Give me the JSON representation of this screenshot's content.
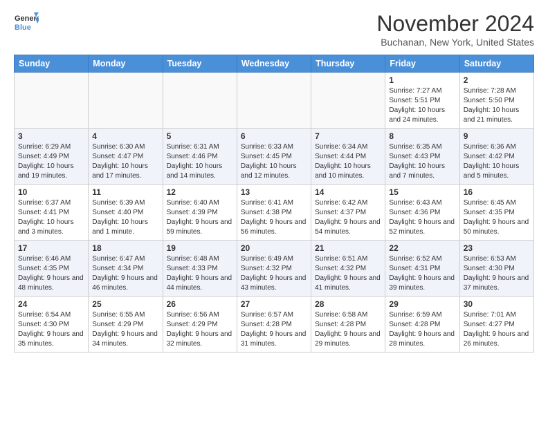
{
  "header": {
    "logo_line1": "General",
    "logo_line2": "Blue",
    "month_title": "November 2024",
    "location": "Buchanan, New York, United States"
  },
  "days_of_week": [
    "Sunday",
    "Monday",
    "Tuesday",
    "Wednesday",
    "Thursday",
    "Friday",
    "Saturday"
  ],
  "weeks": [
    [
      {
        "day": "",
        "info": ""
      },
      {
        "day": "",
        "info": ""
      },
      {
        "day": "",
        "info": ""
      },
      {
        "day": "",
        "info": ""
      },
      {
        "day": "",
        "info": ""
      },
      {
        "day": "1",
        "info": "Sunrise: 7:27 AM\nSunset: 5:51 PM\nDaylight: 10 hours and 24 minutes."
      },
      {
        "day": "2",
        "info": "Sunrise: 7:28 AM\nSunset: 5:50 PM\nDaylight: 10 hours and 21 minutes."
      }
    ],
    [
      {
        "day": "3",
        "info": "Sunrise: 6:29 AM\nSunset: 4:49 PM\nDaylight: 10 hours and 19 minutes."
      },
      {
        "day": "4",
        "info": "Sunrise: 6:30 AM\nSunset: 4:47 PM\nDaylight: 10 hours and 17 minutes."
      },
      {
        "day": "5",
        "info": "Sunrise: 6:31 AM\nSunset: 4:46 PM\nDaylight: 10 hours and 14 minutes."
      },
      {
        "day": "6",
        "info": "Sunrise: 6:33 AM\nSunset: 4:45 PM\nDaylight: 10 hours and 12 minutes."
      },
      {
        "day": "7",
        "info": "Sunrise: 6:34 AM\nSunset: 4:44 PM\nDaylight: 10 hours and 10 minutes."
      },
      {
        "day": "8",
        "info": "Sunrise: 6:35 AM\nSunset: 4:43 PM\nDaylight: 10 hours and 7 minutes."
      },
      {
        "day": "9",
        "info": "Sunrise: 6:36 AM\nSunset: 4:42 PM\nDaylight: 10 hours and 5 minutes."
      }
    ],
    [
      {
        "day": "10",
        "info": "Sunrise: 6:37 AM\nSunset: 4:41 PM\nDaylight: 10 hours and 3 minutes."
      },
      {
        "day": "11",
        "info": "Sunrise: 6:39 AM\nSunset: 4:40 PM\nDaylight: 10 hours and 1 minute."
      },
      {
        "day": "12",
        "info": "Sunrise: 6:40 AM\nSunset: 4:39 PM\nDaylight: 9 hours and 59 minutes."
      },
      {
        "day": "13",
        "info": "Sunrise: 6:41 AM\nSunset: 4:38 PM\nDaylight: 9 hours and 56 minutes."
      },
      {
        "day": "14",
        "info": "Sunrise: 6:42 AM\nSunset: 4:37 PM\nDaylight: 9 hours and 54 minutes."
      },
      {
        "day": "15",
        "info": "Sunrise: 6:43 AM\nSunset: 4:36 PM\nDaylight: 9 hours and 52 minutes."
      },
      {
        "day": "16",
        "info": "Sunrise: 6:45 AM\nSunset: 4:35 PM\nDaylight: 9 hours and 50 minutes."
      }
    ],
    [
      {
        "day": "17",
        "info": "Sunrise: 6:46 AM\nSunset: 4:35 PM\nDaylight: 9 hours and 48 minutes."
      },
      {
        "day": "18",
        "info": "Sunrise: 6:47 AM\nSunset: 4:34 PM\nDaylight: 9 hours and 46 minutes."
      },
      {
        "day": "19",
        "info": "Sunrise: 6:48 AM\nSunset: 4:33 PM\nDaylight: 9 hours and 44 minutes."
      },
      {
        "day": "20",
        "info": "Sunrise: 6:49 AM\nSunset: 4:32 PM\nDaylight: 9 hours and 43 minutes."
      },
      {
        "day": "21",
        "info": "Sunrise: 6:51 AM\nSunset: 4:32 PM\nDaylight: 9 hours and 41 minutes."
      },
      {
        "day": "22",
        "info": "Sunrise: 6:52 AM\nSunset: 4:31 PM\nDaylight: 9 hours and 39 minutes."
      },
      {
        "day": "23",
        "info": "Sunrise: 6:53 AM\nSunset: 4:30 PM\nDaylight: 9 hours and 37 minutes."
      }
    ],
    [
      {
        "day": "24",
        "info": "Sunrise: 6:54 AM\nSunset: 4:30 PM\nDaylight: 9 hours and 35 minutes."
      },
      {
        "day": "25",
        "info": "Sunrise: 6:55 AM\nSunset: 4:29 PM\nDaylight: 9 hours and 34 minutes."
      },
      {
        "day": "26",
        "info": "Sunrise: 6:56 AM\nSunset: 4:29 PM\nDaylight: 9 hours and 32 minutes."
      },
      {
        "day": "27",
        "info": "Sunrise: 6:57 AM\nSunset: 4:28 PM\nDaylight: 9 hours and 31 minutes."
      },
      {
        "day": "28",
        "info": "Sunrise: 6:58 AM\nSunset: 4:28 PM\nDaylight: 9 hours and 29 minutes."
      },
      {
        "day": "29",
        "info": "Sunrise: 6:59 AM\nSunset: 4:28 PM\nDaylight: 9 hours and 28 minutes."
      },
      {
        "day": "30",
        "info": "Sunrise: 7:01 AM\nSunset: 4:27 PM\nDaylight: 9 hours and 26 minutes."
      }
    ]
  ]
}
